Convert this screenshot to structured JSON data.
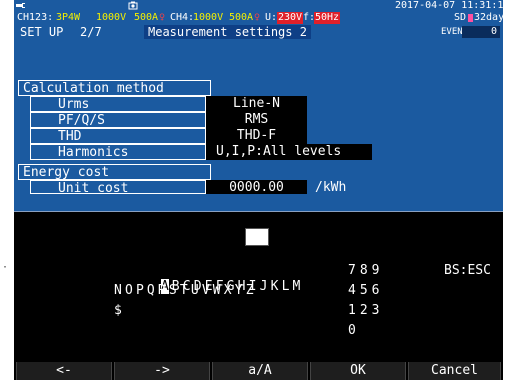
{
  "status_bar": {
    "date_time": "2017-04-07 11:31:10",
    "channel_config_prefix": "CH123:",
    "wiring": "3P4W",
    "ch123_voltage": "1000V",
    "ch123_current": "500A",
    "ch4_prefix": "CH4:",
    "ch4_voltage": "1000V",
    "ch4_current": "500A",
    "u_prefix": "U:",
    "u_value": "230V",
    "f_prefix": "f:",
    "f_value": "50Hz",
    "storage": "SD",
    "storage_days": "32days",
    "icons": [
      "plug-icon",
      "camera-icon",
      "clamp-icon"
    ]
  },
  "title_bar": {
    "setup": "SET UP",
    "page": "2/7",
    "screen_name": "Measurement settings 2",
    "event_label": "EVENT",
    "event_value": "0"
  },
  "settings": {
    "calc_header": "Calculation method",
    "rows": [
      {
        "label": "Urms",
        "value": "Line-N"
      },
      {
        "label": "PF/Q/S",
        "value": "RMS"
      },
      {
        "label": "THD",
        "value": "THD-F"
      },
      {
        "label": "Harmonics",
        "value": "U,I,P:All levels"
      }
    ],
    "energy_header": "Energy cost",
    "unit_cost_label": "Unit cost",
    "unit_cost_value": "0000.00",
    "unit_cost_unit": "/kWh"
  },
  "keyboard": {
    "input_value": "",
    "row1_selected": "A",
    "row1_rest": "BCDEFGHIJKLM",
    "row2": "NOPQRSTUVWXYZ",
    "row3": "$",
    "num_row1": "789",
    "num_row2": "456",
    "num_row3": "123",
    "num_row4": "0",
    "bs_esc": "BS:ESC"
  },
  "function_keys": [
    "<-",
    "->",
    "a/A",
    "OK",
    "Cancel"
  ],
  "colors": {
    "screen_bg": "#1b5aa0",
    "keyboard_bg": "#000000",
    "alert_red": "#e0202a",
    "yellow": "#f4f000"
  }
}
